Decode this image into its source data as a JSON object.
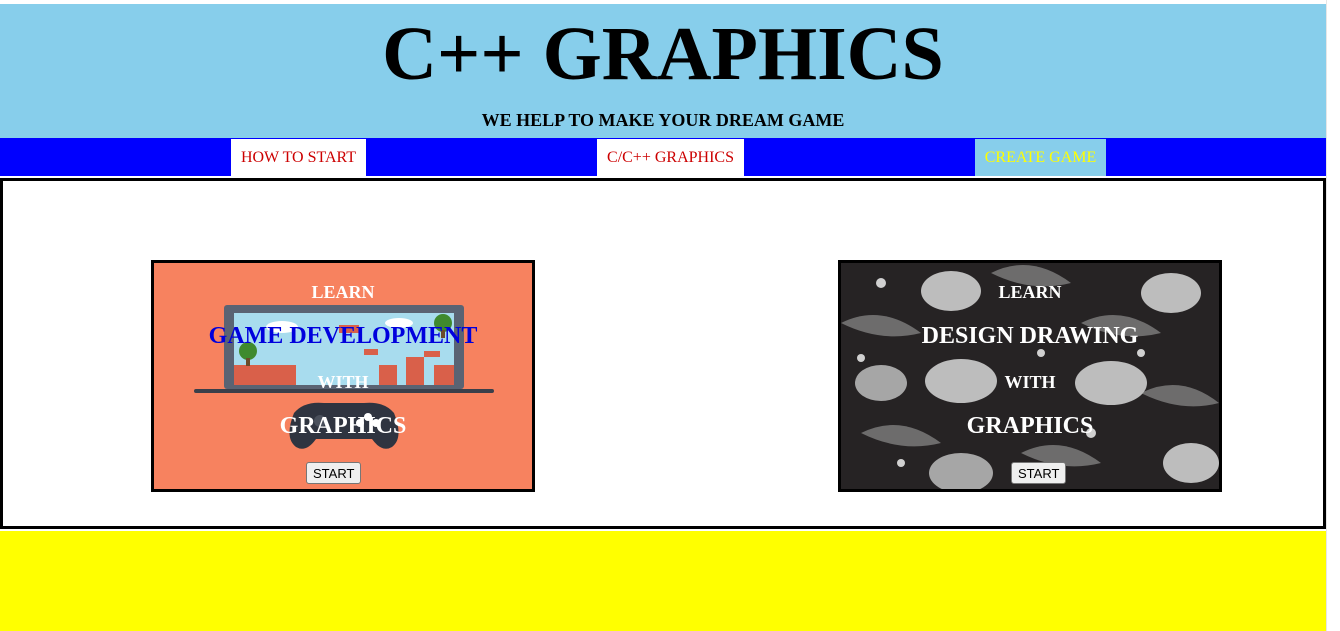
{
  "header": {
    "title": "C++ GRAPHICS",
    "tagline": "WE HELP TO MAKE YOUR DREAM GAME"
  },
  "nav": {
    "items": [
      {
        "label": "HOW TO START"
      },
      {
        "label": "C/C++ GRAPHICS"
      },
      {
        "label": "CREATE GAME"
      }
    ]
  },
  "cards": [
    {
      "learn": "LEARN",
      "subject": "GAME DEVELOPMENT",
      "with": "WITH",
      "graphics": "GRAPHICS",
      "button": "START",
      "background": "#f7825f"
    },
    {
      "learn": "LEARN",
      "subject": "DESIGN DRAWING",
      "with": "WITH",
      "graphics": "GRAPHICS",
      "button": "START",
      "background": "#262324"
    }
  ],
  "colors": {
    "header_bg": "#87ceeb",
    "nav_bg": "#0000ff",
    "nav_link": "#cc0000",
    "nav_highlight": "#ffff00",
    "footer_bg": "#ffff00"
  }
}
